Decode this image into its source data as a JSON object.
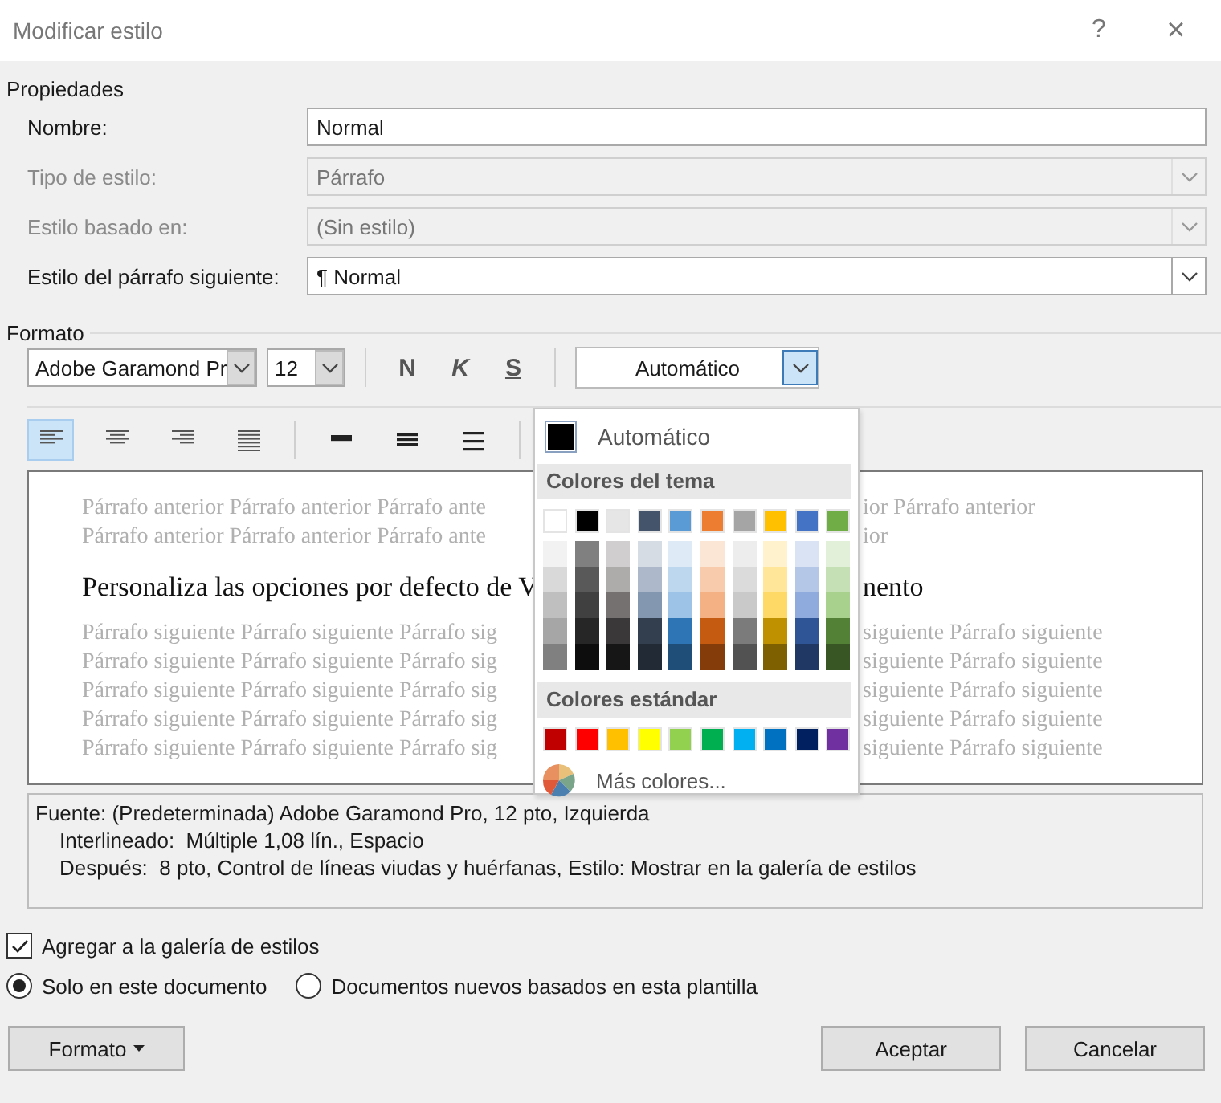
{
  "window": {
    "title": "Modificar estilo",
    "help": "?",
    "close": "×"
  },
  "properties": {
    "heading": "Propiedades",
    "fields": [
      {
        "label": "Nombre:",
        "value": "Normal",
        "kind": "text",
        "disabled": false
      },
      {
        "label": "Tipo de estilo:",
        "value": "Párrafo",
        "kind": "dropdown",
        "disabled": true
      },
      {
        "label": "Estilo basado en:",
        "value": "(Sin estilo)",
        "kind": "dropdown",
        "disabled": true
      },
      {
        "label": "Estilo del párrafo siguiente:",
        "value": "¶ Normal",
        "kind": "dropdown",
        "disabled": false
      }
    ]
  },
  "format": {
    "heading": "Formato",
    "font": "Adobe Garamond Pr",
    "size": "12",
    "style_buttons": [
      {
        "kind": "bold",
        "label": "N"
      },
      {
        "kind": "italic",
        "label": "K"
      },
      {
        "kind": "underline",
        "label": "S"
      }
    ],
    "color": {
      "value": "Automático",
      "expanded": true
    },
    "alignment_buttons": [
      {
        "kind": "left",
        "selected": true
      },
      {
        "kind": "center",
        "selected": false
      },
      {
        "kind": "right",
        "selected": false
      },
      {
        "kind": "justify",
        "selected": false
      }
    ],
    "spacing_buttons": [
      {
        "kind": "single",
        "selected": false
      },
      {
        "kind": "onehalf",
        "selected": false
      },
      {
        "kind": "double",
        "selected": false
      }
    ]
  },
  "color_menu": {
    "automatic": {
      "label": "Automático",
      "color": "#000000"
    },
    "theme_heading": "Colores del tema",
    "theme_colors": [
      {
        "color": "#ffffff",
        "shades": [
          {
            "color": "#f2f2f2"
          },
          {
            "color": "#d9d9d9"
          },
          {
            "color": "#bfbfbf"
          },
          {
            "color": "#a6a6a6"
          },
          {
            "color": "#808080"
          }
        ]
      },
      {
        "color": "#000000",
        "shades": [
          {
            "color": "#808080"
          },
          {
            "color": "#595959"
          },
          {
            "color": "#404040"
          },
          {
            "color": "#262626"
          },
          {
            "color": "#0d0d0d"
          }
        ]
      },
      {
        "color": "#e7e6e6",
        "shades": [
          {
            "color": "#d0cece"
          },
          {
            "color": "#aeabab"
          },
          {
            "color": "#757171"
          },
          {
            "color": "#3a3838"
          },
          {
            "color": "#171616"
          }
        ]
      },
      {
        "color": "#44546a",
        "shades": [
          {
            "color": "#d6dce4"
          },
          {
            "color": "#adb9ca"
          },
          {
            "color": "#8497b0"
          },
          {
            "color": "#333f4f"
          },
          {
            "color": "#222a35"
          }
        ]
      },
      {
        "color": "#5b9bd5",
        "shades": [
          {
            "color": "#deebf6"
          },
          {
            "color": "#bdd7ee"
          },
          {
            "color": "#9dc3e6"
          },
          {
            "color": "#2e75b5"
          },
          {
            "color": "#1f4e79"
          }
        ]
      },
      {
        "color": "#ed7d31",
        "shades": [
          {
            "color": "#fbe5d5"
          },
          {
            "color": "#f8cbad"
          },
          {
            "color": "#f4b183"
          },
          {
            "color": "#c55a11"
          },
          {
            "color": "#843c0b"
          }
        ]
      },
      {
        "color": "#a5a5a5",
        "shades": [
          {
            "color": "#ededed"
          },
          {
            "color": "#dbdbdb"
          },
          {
            "color": "#c9c9c9"
          },
          {
            "color": "#7b7b7b"
          },
          {
            "color": "#525252"
          }
        ]
      },
      {
        "color": "#ffc000",
        "shades": [
          {
            "color": "#fff2cc"
          },
          {
            "color": "#ffe699"
          },
          {
            "color": "#ffd966"
          },
          {
            "color": "#bf9000"
          },
          {
            "color": "#7f6000"
          }
        ]
      },
      {
        "color": "#4472c4",
        "shades": [
          {
            "color": "#dae3f3"
          },
          {
            "color": "#b4c7e7"
          },
          {
            "color": "#8faadc"
          },
          {
            "color": "#2f5597"
          },
          {
            "color": "#203864"
          }
        ]
      },
      {
        "color": "#70ad47",
        "shades": [
          {
            "color": "#e2f0d9"
          },
          {
            "color": "#c5e0b4"
          },
          {
            "color": "#a9d18e"
          },
          {
            "color": "#538135"
          },
          {
            "color": "#375623"
          }
        ]
      }
    ],
    "standard_heading": "Colores estándar",
    "standard_colors": [
      {
        "color": "#c00000"
      },
      {
        "color": "#ff0000"
      },
      {
        "color": "#ffc000"
      },
      {
        "color": "#ffff00"
      },
      {
        "color": "#92d050"
      },
      {
        "color": "#00b050"
      },
      {
        "color": "#00b0f0"
      },
      {
        "color": "#0070c0"
      },
      {
        "color": "#002060"
      },
      {
        "color": "#7030a0"
      }
    ],
    "more": "Más colores..."
  },
  "preview": {
    "previous": [
      {
        "left": "Párrafo anterior Párrafo anterior Párrafo ante",
        "right": "ior Párrafo anterior"
      },
      {
        "left": "Párrafo anterior Párrafo anterior Párrafo ante",
        "right": "ior"
      }
    ],
    "main": {
      "left": "Personaliza las opciones por defecto de V",
      "right": "nento"
    },
    "following": [
      {
        "left": "Párrafo siguiente Párrafo siguiente Párrafo sig",
        "right": "siguiente Párrafo siguiente"
      },
      {
        "left": "Párrafo siguiente Párrafo siguiente Párrafo sig",
        "right": "siguiente Párrafo siguiente"
      },
      {
        "left": "Párrafo siguiente Párrafo siguiente Párrafo sig",
        "right": "siguiente Párrafo siguiente"
      },
      {
        "left": "Párrafo siguiente Párrafo siguiente Párrafo sig",
        "right": "siguiente Párrafo siguiente"
      },
      {
        "left": "Párrafo siguiente Párrafo siguiente Párrafo sig",
        "right": "siguiente Párrafo siguiente"
      }
    ]
  },
  "description": [
    "Fuente: (Predeterminada) Adobe Garamond Pro, 12 pto, Izquierda",
    "Interlineado:  Múltiple 1,08 lín., Espacio",
    "Después:  8 pto, Control de líneas viudas y huérfanas, Estilo: Mostrar en la galería de estilos"
  ],
  "options": {
    "add_to_gallery": {
      "label": "Agregar a la galería de estilos",
      "checked": true
    },
    "scope": [
      {
        "label": "Solo en este documento",
        "selected": true
      },
      {
        "label": "Documentos nuevos basados en esta plantilla",
        "selected": false
      }
    ]
  },
  "buttons": {
    "format": "Formato",
    "ok": "Aceptar",
    "cancel": "Cancelar"
  }
}
